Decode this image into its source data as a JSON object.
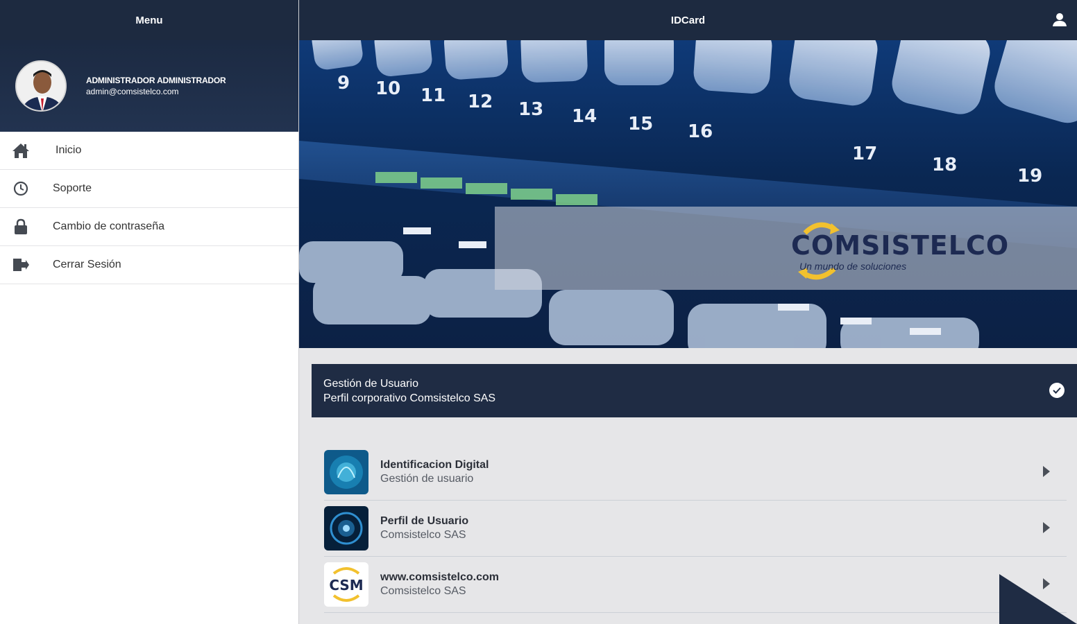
{
  "sidebar": {
    "title": "Menu",
    "user": {
      "name": "ADMINISTRADOR ADMINISTRADOR",
      "email": "admin@comsistelco.com"
    },
    "items": [
      {
        "label": "Inicio",
        "icon": "home-icon"
      },
      {
        "label": "Soporte",
        "icon": "support-icon"
      },
      {
        "label": "Cambio de contraseña",
        "icon": "lock-icon"
      },
      {
        "label": "Cerrar Sesión",
        "icon": "logout-icon"
      }
    ]
  },
  "header": {
    "title": "IDCard",
    "user_icon": "user-icon"
  },
  "banner": {
    "logo_text": "COMSISTELCO",
    "logo_tagline": "Un mundo de soluciones",
    "port_numbers": [
      "9",
      "10",
      "11",
      "12",
      "13",
      "14",
      "15",
      "16",
      "17",
      "18",
      "19"
    ]
  },
  "section": {
    "title": "Gestión de Usuario",
    "subtitle": "Perfil corporativo Comsistelco SAS"
  },
  "list": [
    {
      "title": "Identificacion Digital",
      "subtitle": "Gestión de usuario"
    },
    {
      "title": "Perfil de Usuario",
      "subtitle": "Comsistelco SAS"
    },
    {
      "title": "www.comsistelco.com",
      "subtitle": "Comsistelco SAS"
    }
  ],
  "colors": {
    "navy": "#1d2a40",
    "accent_gold": "#f2c12e"
  }
}
